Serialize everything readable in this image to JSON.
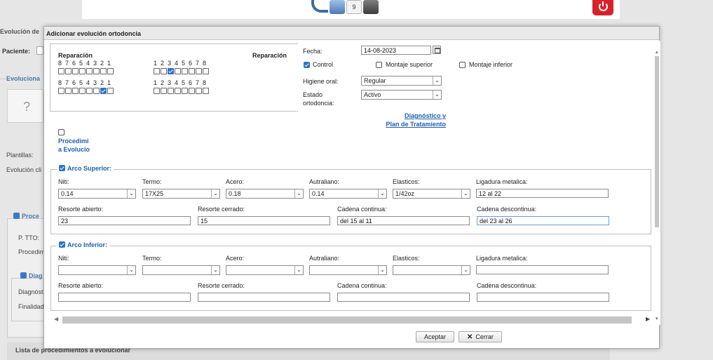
{
  "background": {
    "top_icons": [
      "back-arrow-icon",
      "people-icon",
      "calendar-icon",
      "card-icon"
    ],
    "calendar_day": "9",
    "title": "Evolución de",
    "paciente_label": "Paciente:",
    "evolucionar_label": "Evoluciona",
    "photo_placeholder": "?",
    "plantillas_label": "Plantillas:",
    "evolucion_label": "Evolución cli",
    "procedimientos_label": "Proce",
    "ptto_label": "P. TTO:",
    "procedim_label": "Procedim",
    "diag_label": "Diag",
    "diagnostico_label": "Diagnóst",
    "finalidad_label": "Finalidad",
    "lista_label": "Lista de procedimientos a evolucionar"
  },
  "dialog": {
    "title": "Adicionar evolución ortodoncia",
    "teeth": {
      "left_label": "Reparación",
      "right_label": "Reparación",
      "upper_left_numbers": [
        "8",
        "7",
        "6",
        "5",
        "4",
        "3",
        "2",
        "1"
      ],
      "upper_right_numbers": [
        "1",
        "2",
        "3",
        "4",
        "5",
        "6",
        "7",
        "8"
      ],
      "lower_left_numbers": [
        "8",
        "7",
        "6",
        "5",
        "4",
        "3",
        "2",
        "1"
      ],
      "lower_right_numbers": [
        "1",
        "2",
        "3",
        "4",
        "5",
        "6",
        "7",
        "8"
      ],
      "upper_left_checked": [
        false,
        false,
        false,
        false,
        false,
        false,
        false,
        false
      ],
      "upper_right_checked": [
        false,
        false,
        true,
        false,
        false,
        false,
        false,
        false
      ],
      "lower_left_checked": [
        false,
        false,
        false,
        false,
        false,
        false,
        true,
        false
      ],
      "lower_right_checked": [
        false,
        false,
        false,
        false,
        false,
        false,
        false,
        false
      ]
    },
    "form": {
      "fecha_label": "Fecha:",
      "fecha_value": "14-08-2023",
      "control_label": "Control",
      "control_checked": true,
      "montaje_superior_label": "Montaje superior",
      "montaje_inferior_label": "Montaje inferior",
      "higiene_label": "Higiene oral:",
      "higiene_value": "Regular",
      "estado_label_1": "Estado",
      "estado_label_2": "ortodoncia:",
      "estado_value": "Activo",
      "diagnostico_link_1": "Diagnóstico y",
      "diagnostico_link_2": "Plan de Tratamiento",
      "procedimi_label_1": "Procedimi",
      "procedimi_label_2": "a Evolucio"
    },
    "arco_superior": {
      "title": "Arco Superior:",
      "checked": true,
      "niti_label": "Niti:",
      "niti_value": "0.14",
      "termo_label": "Termo:",
      "termo_value": "17X25",
      "acero_label": "Acero:",
      "acero_value": "0.18",
      "autraliano_label": "Autraliano:",
      "autraliano_value": "0.14",
      "elasticos_label": "Elasticos:",
      "elasticos_value": "1/42oz",
      "ligadura_label": "Ligadura metalica:",
      "ligadura_value": "12 al 22",
      "resorte_abierto_label": "Resorte abierto:",
      "resorte_abierto_value": "23",
      "resorte_cerrado_label": "Resorte cerrado:",
      "resorte_cerrado_value": "15",
      "cadena_continua_label": "Cadena continua:",
      "cadena_continua_value": "del 15 al 11",
      "cadena_descontinua_label": "Cadena descontinua:",
      "cadena_descontinua_value": " del 23 al 26"
    },
    "arco_inferior": {
      "title": "Arco Inferior:",
      "checked": true,
      "niti_label": "Niti:",
      "niti_value": "",
      "termo_label": "Termo:",
      "termo_value": "",
      "acero_label": "Acero:",
      "acero_value": "",
      "autraliano_label": "Autraliano:",
      "autraliano_value": "",
      "elasticos_label": "Elasticos:",
      "elasticos_value": "",
      "ligadura_label": "Ligadura metalica:",
      "ligadura_value": "",
      "resorte_abierto_label": "Resorte abierto:",
      "resorte_abierto_value": "",
      "resorte_cerrado_label": "Resorte cerrado:",
      "resorte_cerrado_value": "",
      "cadena_continua_label": "Cadena continua:",
      "cadena_continua_value": "",
      "cadena_descontinua_label": "Cadena descontinua:",
      "cadena_descontinua_value": ""
    },
    "buttons": {
      "aceptar": "Aceptar",
      "cerrar": "Cerrar"
    }
  },
  "colors": {
    "accent": "#2f73c8",
    "link": "#1d5fae",
    "power": "#d9212b"
  }
}
